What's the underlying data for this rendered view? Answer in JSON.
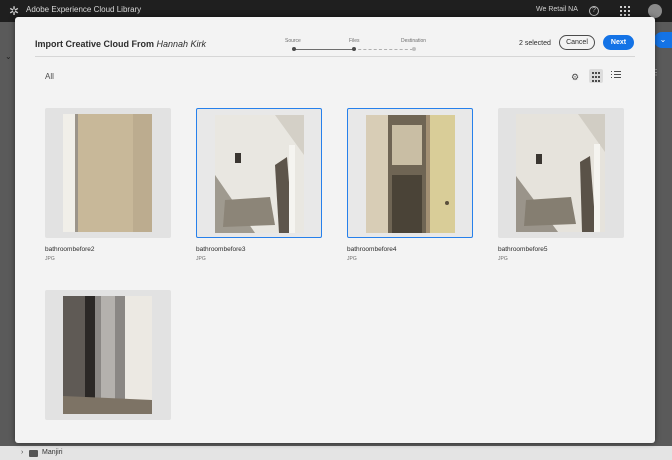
{
  "topbar": {
    "app_title": "Adobe Experience Cloud Library",
    "org_name": "We Retail NA",
    "help_glyph": "?",
    "logo_icon": "adobe-aem-logo-icon"
  },
  "background": {
    "bottom_folder_name": "Manjiri"
  },
  "modal": {
    "title_prefix": "Import Creative Cloud From",
    "title_user": "Hannah Kirk",
    "steps": [
      {
        "label": "Source",
        "state": "completed"
      },
      {
        "label": "Files",
        "state": "current"
      },
      {
        "label": "Destination",
        "state": "upcoming"
      }
    ],
    "selected_count": "2 selected",
    "cancel_label": "Cancel",
    "next_label": "Next",
    "filter_label": "All",
    "view_mode": "grid",
    "accent_color": "#1473e6"
  },
  "assets": [
    {
      "name": "bathroombefore2",
      "type": "JPG",
      "selected": false
    },
    {
      "name": "bathroombefore3",
      "type": "JPG",
      "selected": true
    },
    {
      "name": "bathroombefore4",
      "type": "JPG",
      "selected": true
    },
    {
      "name": "bathroombefore5",
      "type": "JPG",
      "selected": false
    },
    {
      "name": "",
      "type": "",
      "selected": false
    }
  ]
}
